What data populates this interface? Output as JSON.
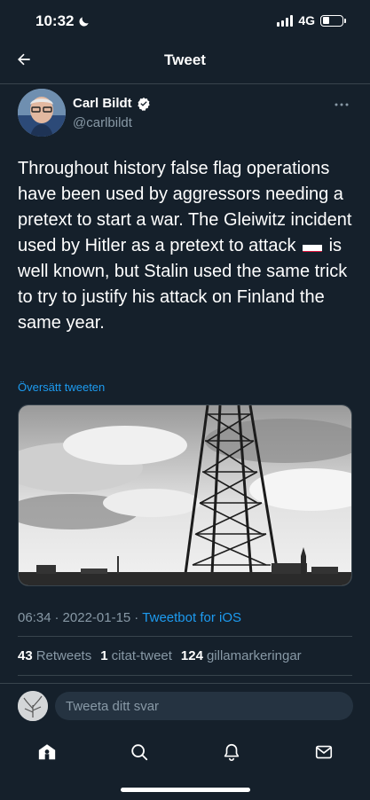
{
  "status_bar": {
    "time": "10:32",
    "network": "4G",
    "icons": [
      "moon-icon",
      "signal-icon",
      "battery-icon"
    ]
  },
  "nav": {
    "title": "Tweet",
    "back_icon": "arrow-left-icon"
  },
  "tweet": {
    "author_name": "Carl Bildt",
    "author_handle": "@carlbildt",
    "verified": true,
    "text_before_flag": "Throughout history false flag operations have been used by aggressors needing a pretext to start a war. The Gleiwitz incident used by Hitler as a pretext to attack ",
    "flag_emoji": "🇵🇱",
    "text_after_flag": " is well known, but Stalin used the same trick to try to justify his attack on Finland the same year.",
    "translate_label": "Översätt tweeten",
    "time": "06:34",
    "separator": "·",
    "date": "2022-01-15",
    "source": "Tweetbot for iOS"
  },
  "stats": {
    "retweets_count": "43",
    "retweets_label": "Retweets",
    "quotes_count": "1",
    "quotes_label": "citat-tweet",
    "likes_count": "124",
    "likes_label": "gillamarkeringar"
  },
  "reply": {
    "placeholder": "Tweeta ditt svar"
  },
  "tab_bar": {
    "items": [
      "home-icon",
      "search-icon",
      "bell-icon",
      "mail-icon"
    ]
  },
  "colors": {
    "background": "#15202b",
    "accent": "#1d9bf0",
    "secondary_text": "#8899a6",
    "divider": "#38444d"
  }
}
